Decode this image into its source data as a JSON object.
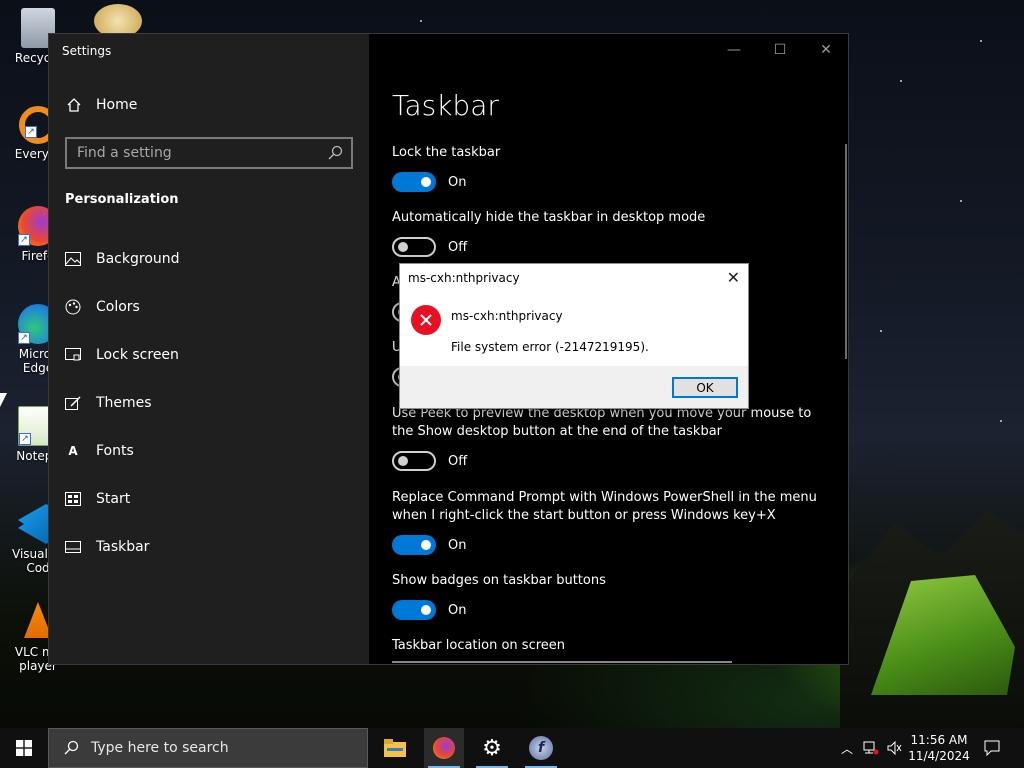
{
  "desktop": {
    "icons": [
      {
        "label": "Recycle",
        "name": "recycle-bin"
      },
      {
        "label": "Everyth",
        "name": "everything"
      },
      {
        "label": "Firefo",
        "name": "firefox"
      },
      {
        "label": "Micros Edge",
        "name": "microsoft-edge"
      },
      {
        "label": "Notepa",
        "name": "notepad-plus-plus"
      },
      {
        "label": "Visual St Cod",
        "name": "visual-studio-code"
      },
      {
        "label": "VLC me player",
        "name": "vlc-media-player"
      }
    ]
  },
  "settings": {
    "window_title": "Settings",
    "home_label": "Home",
    "search_placeholder": "Find a setting",
    "section": "Personalization",
    "nav_items": [
      {
        "label": "Background",
        "icon": "picture-icon"
      },
      {
        "label": "Colors",
        "icon": "palette-icon"
      },
      {
        "label": "Lock screen",
        "icon": "lock-screen-icon"
      },
      {
        "label": "Themes",
        "icon": "brush-icon"
      },
      {
        "label": "Fonts",
        "icon": "font-icon"
      },
      {
        "label": "Start",
        "icon": "start-icon"
      },
      {
        "label": "Taskbar",
        "icon": "taskbar-icon"
      }
    ],
    "title_buttons": {
      "minimize": "—",
      "maximize": "☐",
      "close": "✕"
    },
    "page_title": "Taskbar",
    "settings_list": [
      {
        "label": "Lock the taskbar",
        "state": "On",
        "on": true
      },
      {
        "label": "Automatically hide the taskbar in desktop mode",
        "state": "Off",
        "on": false
      },
      {
        "label": "A",
        "state": "",
        "on": false
      },
      {
        "label": "U",
        "state": "",
        "on": false
      },
      {
        "label": "Use Peek to preview the desktop when you move your mouse to the Show desktop button at the end of the taskbar",
        "state": "Off",
        "on": false
      },
      {
        "label": "Replace Command Prompt with Windows PowerShell in the menu when I right-click the start button or press Windows key+X",
        "state": "On",
        "on": true
      },
      {
        "label": "Show badges on taskbar buttons",
        "state": "On",
        "on": true
      }
    ],
    "location_label": "Taskbar location on screen"
  },
  "dialog": {
    "title": "ms-cxh:nthprivacy",
    "close": "✕",
    "heading": "ms-cxh:nthprivacy",
    "message": "File system error (-2147219195).",
    "ok_label": "OK"
  },
  "taskbar": {
    "search_placeholder": "Type here to search",
    "apps": [
      "file-explorer",
      "firefox",
      "settings",
      "unknown-app"
    ],
    "time": "11:56 AM",
    "date": "11/4/2024"
  },
  "colors": {
    "accent": "#0078d7",
    "error": "#e81123"
  }
}
